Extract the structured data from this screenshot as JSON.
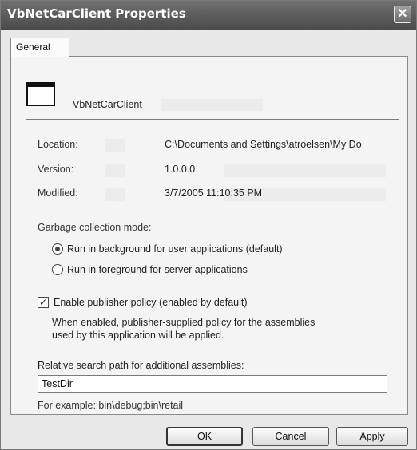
{
  "window": {
    "title": "VbNetCarClient Properties",
    "close_glyph": "✕"
  },
  "tabs": [
    {
      "label": "General",
      "active": true
    }
  ],
  "general": {
    "app_name": "VbNetCarClient",
    "rows": [
      {
        "label": "Location:",
        "value": "C:\\Documents and Settings\\atroelsen\\My Do"
      },
      {
        "label": "Version:",
        "value": "1.0.0.0"
      },
      {
        "label": "Modified:",
        "value": "3/7/2005 11:10:35 PM"
      }
    ],
    "gc": {
      "label": "Garbage collection mode:",
      "options": [
        {
          "label": "Run in background for user applications (default)",
          "checked": true
        },
        {
          "label": "Run in foreground for server applications",
          "checked": false
        }
      ]
    },
    "publisher_policy": {
      "label": "Enable publisher policy (enabled by default)",
      "checked": true,
      "check_glyph": "✓",
      "description": [
        "When enabled, publisher-supplied policy for the assemblies",
        "used by this application will be applied."
      ]
    },
    "search_path": {
      "label": "Relative search path for additional assemblies:",
      "value": "TestDir",
      "example": "For example: bin\\debug;bin\\retail"
    }
  },
  "buttons": {
    "ok": "OK",
    "cancel": "Cancel",
    "apply": "Apply"
  },
  "icons": {
    "app": "application-window-icon",
    "close": "close-icon"
  },
  "colors": {
    "titlebar": "#5a5a5a",
    "dialog_bg": "#e8e8e8",
    "panel_bg": "#f4f4f4"
  }
}
